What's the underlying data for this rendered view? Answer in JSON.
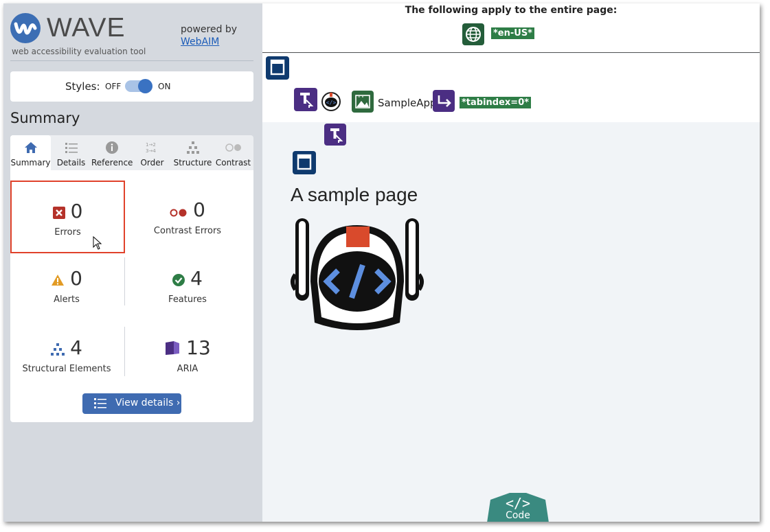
{
  "sidebar": {
    "logo_text": "WAVE",
    "logo_sub": "web accessibility evaluation tool",
    "powered_by": "powered by",
    "webaim_link": "WebAIM",
    "styles": {
      "label": "Styles:",
      "off": "OFF",
      "on": "ON",
      "enabled": true
    },
    "summary_heading": "Summary",
    "tabs": [
      {
        "label": "Summary",
        "icon": "home-icon",
        "active": true
      },
      {
        "label": "Details",
        "icon": "list-icon"
      },
      {
        "label": "Reference",
        "icon": "info-icon"
      },
      {
        "label": "Order",
        "icon": "order-icon"
      },
      {
        "label": "Structure",
        "icon": "structure-icon"
      },
      {
        "label": "Contrast",
        "icon": "contrast-icon"
      }
    ],
    "stats": {
      "errors": {
        "count": "0",
        "label": "Errors"
      },
      "contrast_errors": {
        "count": "0",
        "label": "Contrast Errors"
      },
      "alerts": {
        "count": "0",
        "label": "Alerts"
      },
      "features": {
        "count": "4",
        "label": "Features"
      },
      "structural": {
        "count": "4",
        "label": "Structural Elements"
      },
      "aria": {
        "count": "13",
        "label": "ARIA"
      }
    },
    "view_details": "View details ›"
  },
  "main": {
    "page_notice": "The following apply to the entire page:",
    "lang_tag": "*en-US*",
    "sample_app": "SampleApp",
    "tabindex_tag": "*tabindex=0*",
    "page_title": "A sample page",
    "code_button": "Code"
  },
  "colors": {
    "wave_blue": "#3c6eb4",
    "error_red": "#b5322a",
    "feature_green": "#2e7d46",
    "aria_purple": "#4b2e83",
    "structure_navy": "#0f3a6e",
    "code_teal": "#3a8a80"
  }
}
